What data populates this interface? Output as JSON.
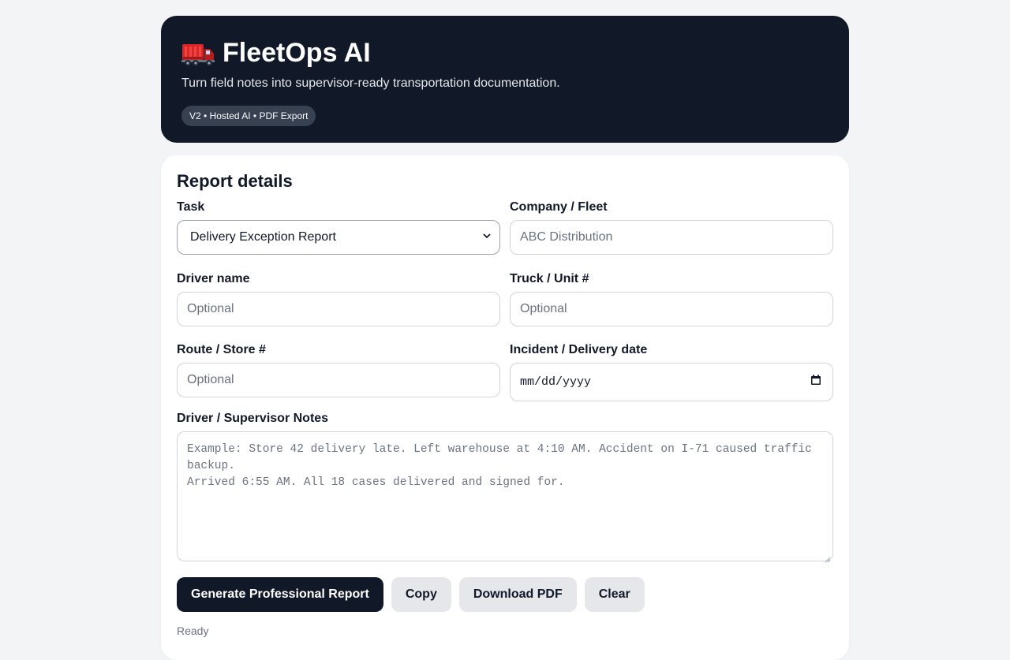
{
  "header": {
    "icon": "truck-icon",
    "title": "FleetOps AI",
    "subtitle": "Turn field notes into supervisor-ready transportation documentation.",
    "badge": "V2 • Hosted AI • PDF Export"
  },
  "form": {
    "heading": "Report details",
    "task": {
      "label": "Task",
      "value": "Delivery Exception Report"
    },
    "company": {
      "label": "Company / Fleet",
      "placeholder": "ABC Distribution"
    },
    "driver": {
      "label": "Driver name",
      "placeholder": "Optional"
    },
    "truck": {
      "label": "Truck / Unit #",
      "placeholder": "Optional"
    },
    "route": {
      "label": "Route / Store #",
      "placeholder": "Optional"
    },
    "date": {
      "label": "Incident / Delivery date",
      "placeholder": "mm/dd/yyyy"
    },
    "notes": {
      "label": "Driver / Supervisor Notes",
      "placeholder": "Example: Store 42 delivery late. Left warehouse at 4:10 AM. Accident on I-71 caused traffic backup.\nArrived 6:55 AM. All 18 cases delivered and signed for."
    }
  },
  "actions": {
    "generate": "Generate Professional Report",
    "copy": "Copy",
    "download": "Download PDF",
    "clear": "Clear"
  },
  "status": "Ready",
  "colors": {
    "header_bg": "#111827",
    "primary_button": "#111827",
    "secondary_button": "#e5e7eb",
    "page_bg": "#f3f4f6"
  }
}
